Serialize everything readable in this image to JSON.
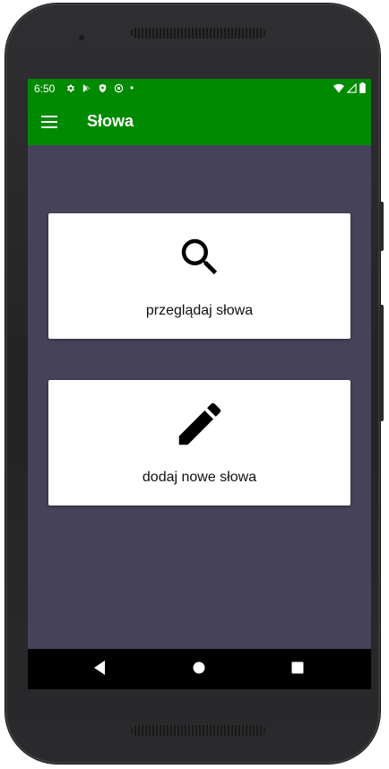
{
  "status_bar": {
    "time": "6:50",
    "dot": "•",
    "icons": [
      "gear-icon",
      "play-store-icon",
      "shield-icon",
      "vpn-icon"
    ],
    "right_icons": [
      "wifi-icon",
      "signal-icon",
      "battery-icon"
    ]
  },
  "toolbar": {
    "title": "Słowa",
    "background_color": "#008a00"
  },
  "cards": [
    {
      "icon": "search-icon",
      "label": "przeglądaj słowa"
    },
    {
      "icon": "pencil-icon",
      "label": "dodaj nowe słowa"
    }
  ],
  "nav_bar": {
    "buttons": [
      "back-icon",
      "home-icon",
      "recents-icon"
    ]
  },
  "colors": {
    "accent": "#008a00",
    "screen_background": "#45425a",
    "card_background": "#ffffff"
  }
}
